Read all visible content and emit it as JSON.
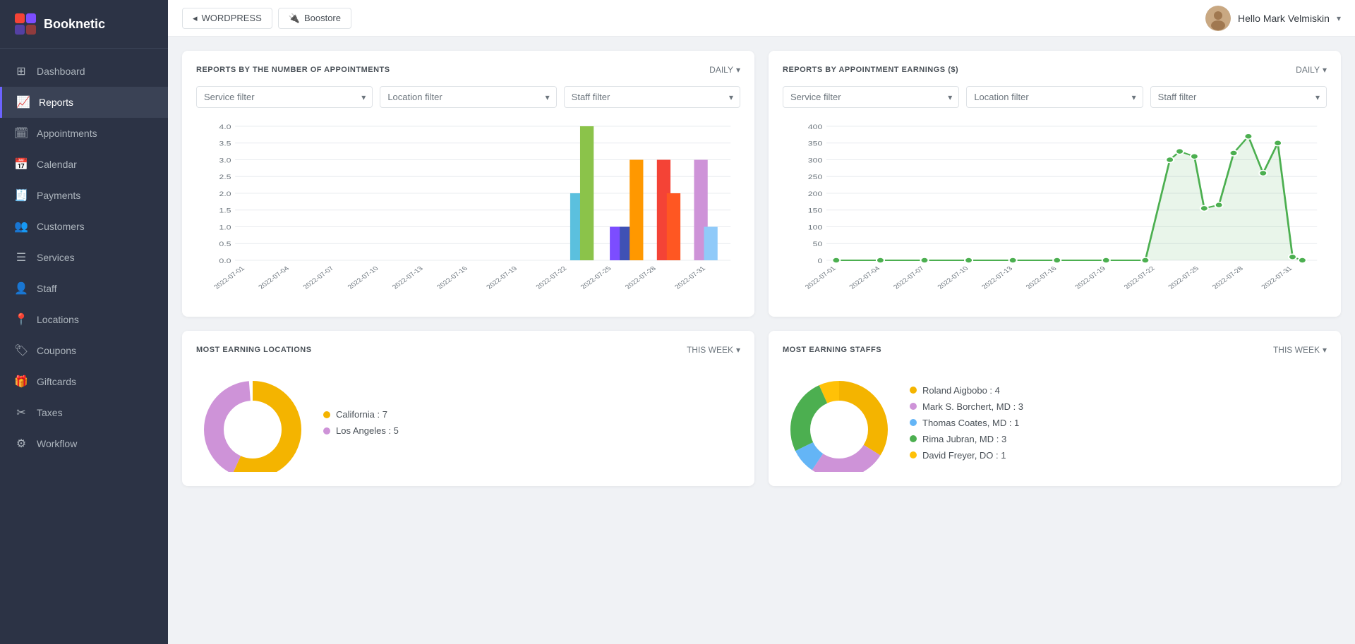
{
  "app": {
    "name": "Booknetic"
  },
  "topbar": {
    "btn1": "WORDPRESS",
    "btn2": "Boostore",
    "user": "Hello Mark Velmiskin"
  },
  "sidebar": {
    "items": [
      {
        "id": "dashboard",
        "label": "Dashboard",
        "icon": "⊞"
      },
      {
        "id": "reports",
        "label": "Reports",
        "icon": "📈",
        "active": true
      },
      {
        "id": "appointments",
        "label": "Appointments",
        "icon": "🗓"
      },
      {
        "id": "calendar",
        "label": "Calendar",
        "icon": "📅"
      },
      {
        "id": "payments",
        "label": "Payments",
        "icon": "🧾"
      },
      {
        "id": "customers",
        "label": "Customers",
        "icon": "👥"
      },
      {
        "id": "services",
        "label": "Services",
        "icon": "☰"
      },
      {
        "id": "staff",
        "label": "Staff",
        "icon": "👤"
      },
      {
        "id": "locations",
        "label": "Locations",
        "icon": "📍"
      },
      {
        "id": "coupons",
        "label": "Coupons",
        "icon": "🏷"
      },
      {
        "id": "giftcards",
        "label": "Giftcards",
        "icon": "🎁"
      },
      {
        "id": "taxes",
        "label": "Taxes",
        "icon": "✂"
      },
      {
        "id": "workflow",
        "label": "Workflow",
        "icon": "⚙"
      }
    ]
  },
  "chart1": {
    "title": "REPORTS BY THE NUMBER OF APPOINTMENTS",
    "period": "DAILY",
    "filters": {
      "service": "Service filter",
      "location": "Location filter",
      "staff": "Staff filter"
    },
    "yLabels": [
      "0",
      "0.5",
      "1.0",
      "1.5",
      "2.0",
      "2.5",
      "3.0",
      "3.5",
      "4.0"
    ],
    "bars": [
      {
        "date": "2022-07-22",
        "value": 2.0,
        "color": "#5bc0de"
      },
      {
        "date": "2022-07-22b",
        "value": 4.0,
        "color": "#8bc34a"
      },
      {
        "date": "2022-07-25",
        "value": 1.0,
        "color": "#7c4dff"
      },
      {
        "date": "2022-07-25b",
        "value": 1.0,
        "color": "#3f51b5"
      },
      {
        "date": "2022-07-25c",
        "value": 3.0,
        "color": "#ff9800"
      },
      {
        "date": "2022-07-28",
        "value": 3.0,
        "color": "#f44336"
      },
      {
        "date": "2022-07-28b",
        "value": 2.0,
        "color": "#ff5722"
      },
      {
        "date": "2022-07-31",
        "value": 3.0,
        "color": "#ce93d8"
      },
      {
        "date": "2022-07-31b",
        "value": 1.0,
        "color": "#90caf9"
      }
    ],
    "xLabels": [
      "2022-07-01",
      "2022-07-04",
      "2022-07-07",
      "2022-07-10",
      "2022-07-13",
      "2022-07-16",
      "2022-07-19",
      "2022-07-22",
      "2022-07-25",
      "2022-07-28",
      "2022-07-31"
    ]
  },
  "chart2": {
    "title": "REPORTS BY APPOINTMENT EARNINGS ($)",
    "period": "DAILY",
    "filters": {
      "service": "Service filter",
      "location": "Location filter",
      "staff": "Staff filter"
    },
    "yLabels": [
      "0",
      "50",
      "100",
      "150",
      "200",
      "250",
      "300",
      "350",
      "400"
    ],
    "xLabels": [
      "2022-07-01",
      "2022-07-04",
      "2022-07-07",
      "2022-07-10",
      "2022-07-13",
      "2022-07-16",
      "2022-07-19",
      "2022-07-22",
      "2022-07-25",
      "2022-07-28",
      "2022-07-31"
    ]
  },
  "chart3": {
    "title": "MOST EARNING LOCATIONS",
    "period": "THIS WEEK",
    "legend": [
      {
        "label": "California : 7",
        "color": "#f4b400"
      },
      {
        "label": "Los Angeles : 5",
        "color": "#ce93d8"
      }
    ]
  },
  "chart4": {
    "title": "MOST EARNING STAFFS",
    "period": "THIS WEEK",
    "legend": [
      {
        "label": "Roland Aigbobo : 4",
        "color": "#f4b400"
      },
      {
        "label": "Mark S. Borchert, MD : 3",
        "color": "#ce93d8"
      },
      {
        "label": "Thomas Coates, MD : 1",
        "color": "#64b5f6"
      },
      {
        "label": "Rima Jubran, MD : 3",
        "color": "#4caf50"
      },
      {
        "label": "David Freyer, DO : 1",
        "color": "#ffc107"
      }
    ]
  }
}
